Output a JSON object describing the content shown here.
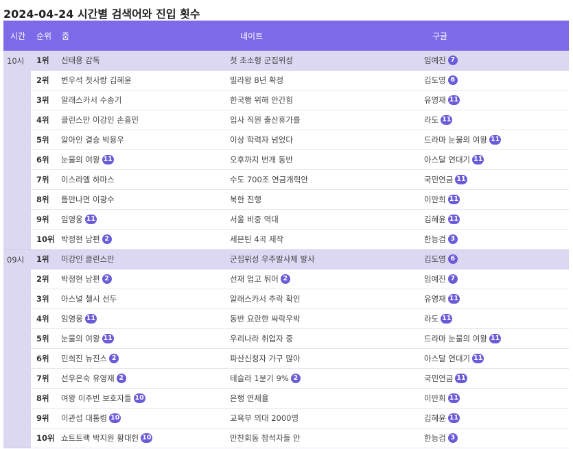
{
  "title": "2024-04-24 시간별 검색어와 진입 횟수",
  "headers": {
    "hour": "시간",
    "rank": "순위",
    "zum": "줌",
    "nate": "네이트",
    "google": "구글"
  },
  "groups": [
    {
      "hour": "10시",
      "rows": [
        {
          "rank": "1위",
          "zum": {
            "kw": "신태용 감독",
            "n": null
          },
          "nate": {
            "kw": "첫 초소형 군집위성",
            "n": null
          },
          "google": {
            "kw": "임예진",
            "n": "7"
          }
        },
        {
          "rank": "2위",
          "zum": {
            "kw": "변우석 첫사랑 김혜윤",
            "n": null
          },
          "nate": {
            "kw": "빌라왕 8년 확정",
            "n": null
          },
          "google": {
            "kw": "김도영",
            "n": "6"
          }
        },
        {
          "rank": "3위",
          "zum": {
            "kw": "알래스카서 수송기",
            "n": null
          },
          "nate": {
            "kw": "한국행 위해 안간힘",
            "n": null
          },
          "google": {
            "kw": "유영재",
            "n": "11"
          }
        },
        {
          "rank": "4위",
          "zum": {
            "kw": "클린스만 이강인 손흥민",
            "n": null
          },
          "nate": {
            "kw": "입사 직원 출산휴가를",
            "n": null
          },
          "google": {
            "kw": "라도",
            "n": "11"
          }
        },
        {
          "rank": "5위",
          "zum": {
            "kw": "알아인 결승 박용우",
            "n": null
          },
          "nate": {
            "kw": "이상 학력자 넘었다",
            "n": null
          },
          "google": {
            "kw": "드라마 눈물의 여왕",
            "n": "11"
          }
        },
        {
          "rank": "6위",
          "zum": {
            "kw": "눈물의 여왕",
            "n": "11"
          },
          "nate": {
            "kw": "오후까지 번개 동반",
            "n": null
          },
          "google": {
            "kw": "아스달 연대기",
            "n": "11"
          }
        },
        {
          "rank": "7위",
          "zum": {
            "kw": "이스라엘 하마스",
            "n": null
          },
          "nate": {
            "kw": "수도 700조 연금개혁안",
            "n": null
          },
          "google": {
            "kw": "국민연금",
            "n": "11"
          }
        },
        {
          "rank": "8위",
          "zum": {
            "kw": "틈만나면 이광수",
            "n": null
          },
          "nate": {
            "kw": "북한 진행",
            "n": null
          },
          "google": {
            "kw": "이만희",
            "n": "11"
          }
        },
        {
          "rank": "9위",
          "zum": {
            "kw": "임영웅",
            "n": "11"
          },
          "nate": {
            "kw": "서울 비중 역대",
            "n": null
          },
          "google": {
            "kw": "김혜윤",
            "n": "11"
          }
        },
        {
          "rank": "10위",
          "zum": {
            "kw": "박정현 남편",
            "n": "2"
          },
          "nate": {
            "kw": "세븐틴 4곡 제작",
            "n": null
          },
          "google": {
            "kw": "한능검",
            "n": "3"
          }
        }
      ]
    },
    {
      "hour": "09시",
      "rows": [
        {
          "rank": "1위",
          "zum": {
            "kw": "이강인 클린스만",
            "n": null
          },
          "nate": {
            "kw": "군집위성 우주발사체 발사",
            "n": null
          },
          "google": {
            "kw": "김도영",
            "n": "6"
          }
        },
        {
          "rank": "2위",
          "zum": {
            "kw": "박정현 남편",
            "n": "2"
          },
          "nate": {
            "kw": "선재 업고 튀어",
            "n": "2"
          },
          "google": {
            "kw": "임예진",
            "n": "7"
          }
        },
        {
          "rank": "3위",
          "zum": {
            "kw": "아스널 첼시 선두",
            "n": null
          },
          "nate": {
            "kw": "알래스카서 추락 확인",
            "n": null
          },
          "google": {
            "kw": "유영재",
            "n": "11"
          }
        },
        {
          "rank": "4위",
          "zum": {
            "kw": "임영웅",
            "n": "11"
          },
          "nate": {
            "kw": "동반 요란한 싸락우박",
            "n": null
          },
          "google": {
            "kw": "라도",
            "n": "11"
          }
        },
        {
          "rank": "5위",
          "zum": {
            "kw": "눈물의 여왕",
            "n": "11"
          },
          "nate": {
            "kw": "우리나라 취업자 중",
            "n": null
          },
          "google": {
            "kw": "드라마 눈물의 여왕",
            "n": "11"
          }
        },
        {
          "rank": "6위",
          "zum": {
            "kw": "민희진 뉴진스",
            "n": "2"
          },
          "nate": {
            "kw": "파산신청자 가구 많아",
            "n": null
          },
          "google": {
            "kw": "아스달 연대기",
            "n": "11"
          }
        },
        {
          "rank": "7위",
          "zum": {
            "kw": "선우은숙 유영재",
            "n": "2"
          },
          "nate": {
            "kw": "테슬라 1분기 9%",
            "n": "2"
          },
          "google": {
            "kw": "국민연금",
            "n": "11"
          }
        },
        {
          "rank": "8위",
          "zum": {
            "kw": "여왕 이주빈 보호자들",
            "n": "10"
          },
          "nate": {
            "kw": "은행 연체율",
            "n": null
          },
          "google": {
            "kw": "이만희",
            "n": "11"
          }
        },
        {
          "rank": "9위",
          "zum": {
            "kw": "이관섭 대통령",
            "n": "10"
          },
          "nate": {
            "kw": "교육부 의대 2000명",
            "n": null
          },
          "google": {
            "kw": "김혜윤",
            "n": "11"
          }
        },
        {
          "rank": "10위",
          "zum": {
            "kw": "쇼트트랙 박지원 황대헌",
            "n": "10"
          },
          "nate": {
            "kw": "만찬회동 참석자들 안",
            "n": null
          },
          "google": {
            "kw": "한능검",
            "n": "3"
          }
        }
      ]
    }
  ]
}
